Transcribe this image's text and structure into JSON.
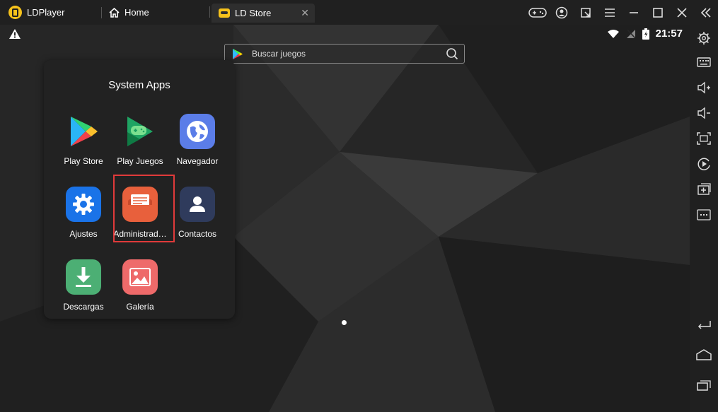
{
  "titlebar": {
    "app_name": "LDPlayer",
    "home_tab": "Home",
    "store_tab": "LD Store",
    "close_tab_glyph": "✕"
  },
  "status": {
    "time": "21:57"
  },
  "search": {
    "placeholder": "Buscar juegos"
  },
  "folder": {
    "title": "System Apps",
    "apps": [
      {
        "label": "Play Store",
        "icon": "play-store-icon"
      },
      {
        "label": "Play Juegos",
        "icon": "play-games-icon"
      },
      {
        "label": "Navegador",
        "icon": "browser-icon"
      },
      {
        "label": "Ajustes",
        "icon": "settings-icon"
      },
      {
        "label": "Administrad…",
        "icon": "file-manager-icon"
      },
      {
        "label": "Contactos",
        "icon": "contacts-icon"
      },
      {
        "label": "Descargas",
        "icon": "downloads-icon"
      },
      {
        "label": "Galería",
        "icon": "gallery-icon"
      }
    ]
  },
  "colors": {
    "accent": "#f6c21b",
    "highlight": "#e03a3a",
    "settings": "#1a73e8",
    "browser": "#5b7de8",
    "file_manager": "#e8603c",
    "contacts": "#2f3b5c",
    "downloads": "#4caf74",
    "gallery": "#ee6a6a"
  }
}
